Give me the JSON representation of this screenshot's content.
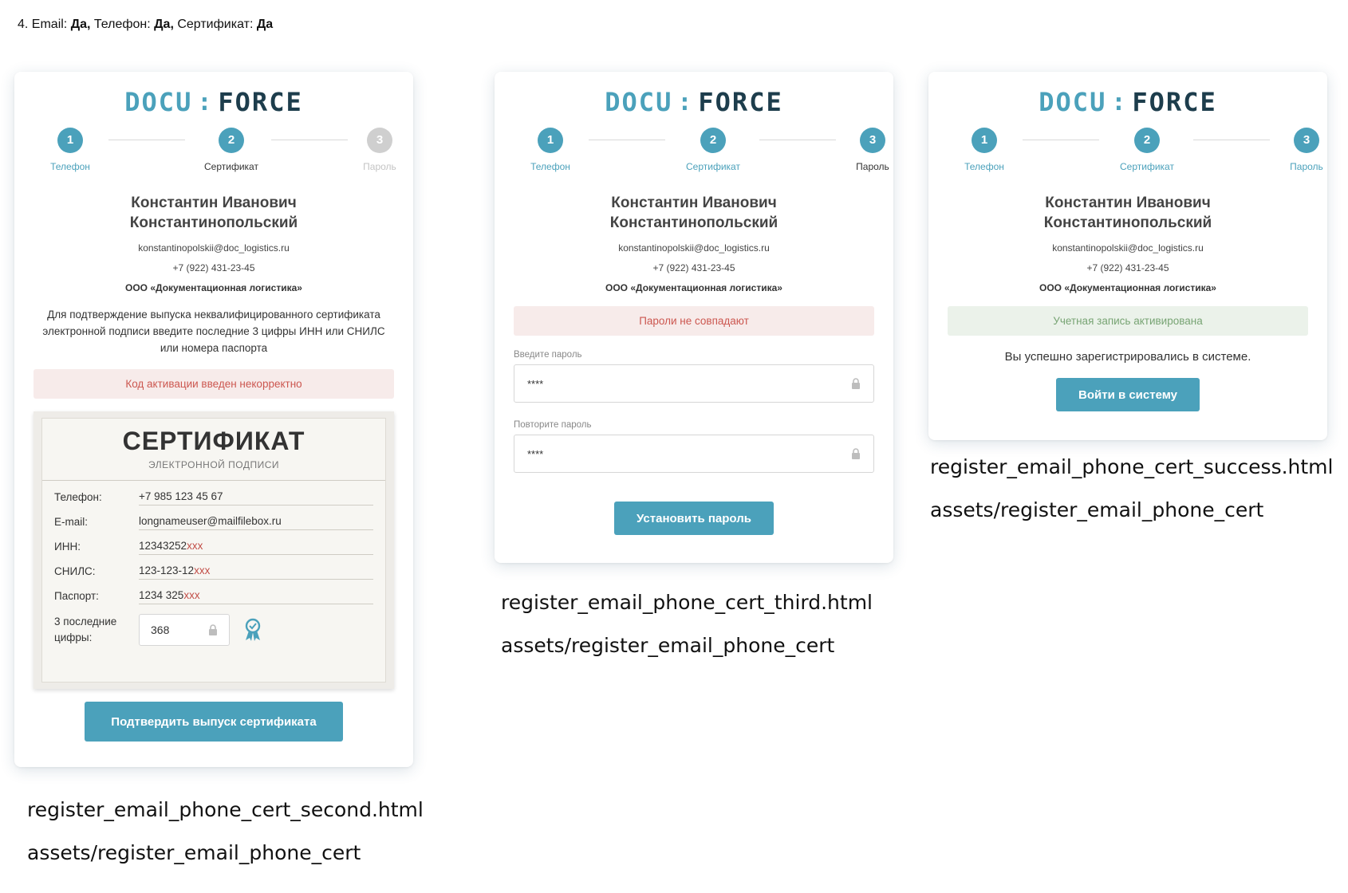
{
  "heading": {
    "prefix": "4. Email: ",
    "email_value": "Да,",
    "phone_label": " Телефон: ",
    "phone_value": "Да,",
    "cert_label": " Сертификат: ",
    "cert_value": "Да"
  },
  "logo": {
    "left": "DOCU",
    "separator": ":",
    "right": "FORCE"
  },
  "steps": {
    "step1": "Телефон",
    "step2": "Сертификат",
    "step3": "Пароль",
    "num1": "1",
    "num2": "2",
    "num3": "3"
  },
  "user": {
    "name_line1": "Константин Иванович",
    "name_line2": "Константинопольский",
    "email": "konstantinopolskii@doc_logistics.ru",
    "phone": "+7 (922) 431-23-45",
    "org": "ООО «Документационная логистика»"
  },
  "card1": {
    "description": "Для подтверждение выпуска неквалифицированного сертификата электронной подписи введите последние 3 цифры ИНН или СНИЛС или номера паспорта",
    "error": "Код активации введен некорректно",
    "certificate": {
      "title": "СЕРТИФИКАТ",
      "subtitle": "ЭЛЕКТРОННОЙ ПОДПИСИ",
      "rows": [
        {
          "label": "Телефон:",
          "value": "+7 985 123 45 67",
          "masked": ""
        },
        {
          "label": "E-mail:",
          "value": "longnameuser@mailfilebox.ru",
          "masked": ""
        },
        {
          "label": "ИНН:",
          "value": "12343252",
          "masked": "xxx"
        },
        {
          "label": "СНИЛС:",
          "value": "123-123-12",
          "masked": "xxx"
        },
        {
          "label": "Паспорт:",
          "value": "1234 325",
          "masked": "xxx"
        }
      ],
      "last_digits_label_1": "3 последние",
      "last_digits_label_2": "цифры:",
      "last_digits_value": "368"
    },
    "button": "Подтвердить выпуск сертификата"
  },
  "card2": {
    "error": "Пароли не совпадают",
    "password_label": "Введите пароль",
    "password_value": "****",
    "repeat_label": "Повторите пароль",
    "repeat_value": "****",
    "button": "Установить пароль"
  },
  "card3": {
    "status": "Учетная запись активирована",
    "message": "Вы успешно зарегистрировались в системе.",
    "button": "Войти в систему"
  },
  "captions": {
    "c1_file": "register_email_phone_cert_second.html",
    "c1_assets": "assets/register_email_phone_cert",
    "c2_file": "register_email_phone_cert_third.html",
    "c2_assets": "assets/register_email_phone_cert",
    "c3_file": "register_email_phone_cert_success.html",
    "c3_assets": "assets/register_email_phone_cert"
  },
  "colors": {
    "accent": "#4ba1bb",
    "logo_dark": "#1d3d4c",
    "error_bg": "#f7ebea",
    "error_text": "#cc5750",
    "success_bg": "#ebf2ea",
    "success_text": "#78a474"
  }
}
